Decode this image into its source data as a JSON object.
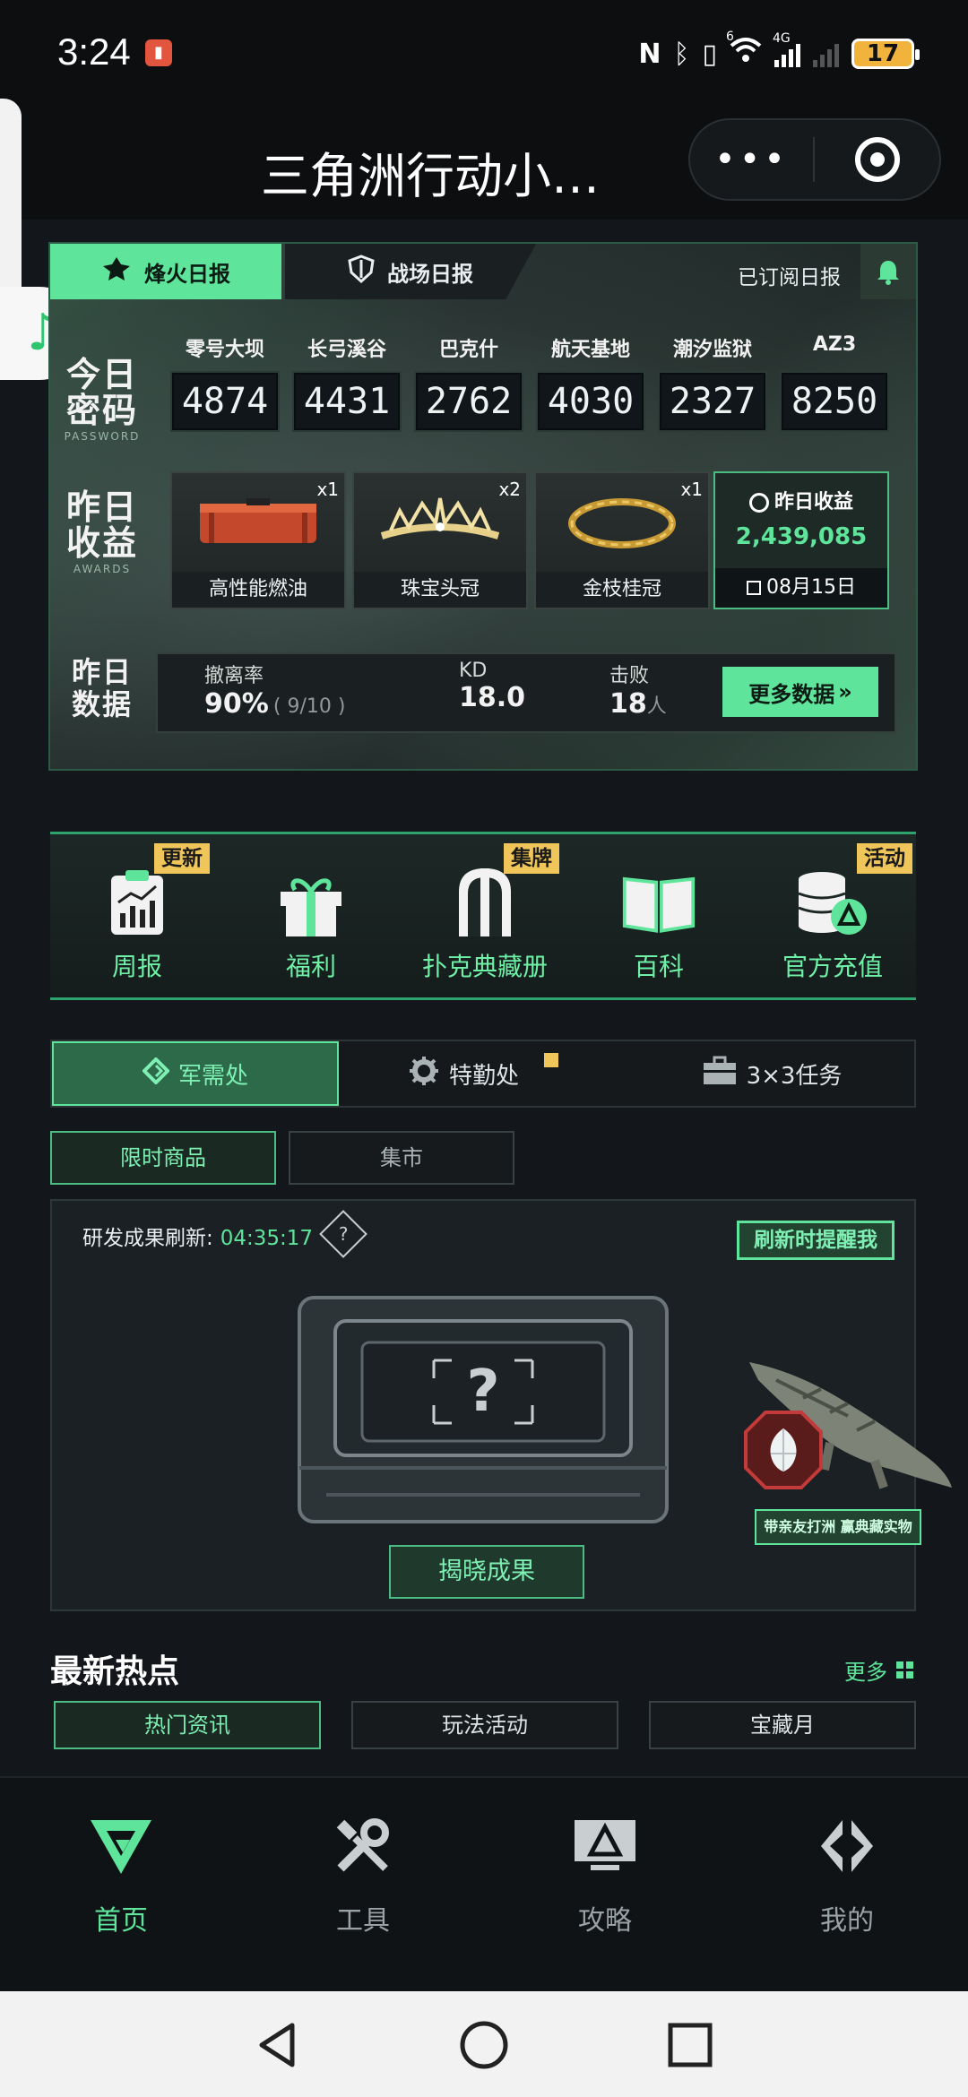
{
  "status_bar": {
    "time": "3:24",
    "battery": "17",
    "network": "4G",
    "signal_strength": "6"
  },
  "title_bar": {
    "title": "三角洲行动小…",
    "more_label": "•••"
  },
  "report_card": {
    "tabs": [
      {
        "label": "烽火日报",
        "active": true
      },
      {
        "label": "战场日报",
        "active": false
      }
    ],
    "subscribed_label": "已订阅日报",
    "password_section": {
      "title_line1": "今日",
      "title_line2": "密码",
      "subtitle": "PASSWORD",
      "codes": [
        {
          "map": "零号大坝",
          "code": "4874"
        },
        {
          "map": "长弓溪谷",
          "code": "4431"
        },
        {
          "map": "巴克什",
          "code": "2762"
        },
        {
          "map": "航天基地",
          "code": "4030"
        },
        {
          "map": "潮汐监狱",
          "code": "2327"
        },
        {
          "map": "AZ3",
          "code": "8250"
        }
      ]
    },
    "awards_section": {
      "title_line1": "昨日",
      "title_line2": "收益",
      "subtitle": "AWARDS",
      "items": [
        {
          "name": "高性能燃油",
          "qty": "x1"
        },
        {
          "name": "珠宝头冠",
          "qty": "x2"
        },
        {
          "name": "金枝桂冠",
          "qty": "x1"
        }
      ],
      "income_label": "昨日收益",
      "income_value": "2,439,085",
      "date": "08月15日"
    },
    "stats_section": {
      "title_line1": "昨日",
      "title_line2": "数据",
      "evac_label": "撤离率",
      "evac_value": "90%",
      "evac_detail": "( 9/10 )",
      "kd_label": "KD",
      "kd_value": "18.0",
      "kills_label": "击败",
      "kills_value": "18",
      "kills_unit": "人",
      "more_data_label": "更多数据"
    }
  },
  "quick_menu": [
    {
      "label": "周报",
      "tag": "更新",
      "icon": "report-clipboard-icon"
    },
    {
      "label": "福利",
      "tag": "",
      "icon": "gift-icon"
    },
    {
      "label": "扑克典藏册",
      "tag": "集牌",
      "icon": "card-album-icon"
    },
    {
      "label": "百科",
      "tag": "",
      "icon": "book-icon"
    },
    {
      "label": "官方充值",
      "tag": "活动",
      "icon": "coin-stack-icon"
    }
  ],
  "section_tabs": [
    {
      "label": "军需处",
      "active": true
    },
    {
      "label": "特勤处",
      "active": false
    },
    {
      "label": "3×3任务",
      "active": false
    }
  ],
  "sub_tabs": [
    {
      "label": "限时商品",
      "active": true
    },
    {
      "label": "集市",
      "active": false
    }
  ],
  "research": {
    "refresh_label": "研发成果刷新:",
    "refresh_timer": "04:35:17",
    "remind_label": "刷新时提醒我",
    "mystery_symbol": "?",
    "reveal_label": "揭晓成果",
    "promo_label": "带亲友打洲 赢典藏实物"
  },
  "news": {
    "title": "最新热点",
    "more_label": "更多",
    "tabs": [
      {
        "label": "热门资讯",
        "active": true
      },
      {
        "label": "玩法活动",
        "active": false
      },
      {
        "label": "宝藏月",
        "active": false
      }
    ]
  },
  "bottom_nav": [
    {
      "label": "首页",
      "active": true,
      "icon": "home-logo-icon"
    },
    {
      "label": "工具",
      "active": false,
      "icon": "tools-icon"
    },
    {
      "label": "攻略",
      "active": false,
      "icon": "guide-monitor-icon"
    },
    {
      "label": "我的",
      "active": false,
      "icon": "profile-logo-icon"
    }
  ],
  "colors": {
    "accent": "#5ee59b",
    "background": "#13171b",
    "tag_yellow": "#f0c65a"
  }
}
